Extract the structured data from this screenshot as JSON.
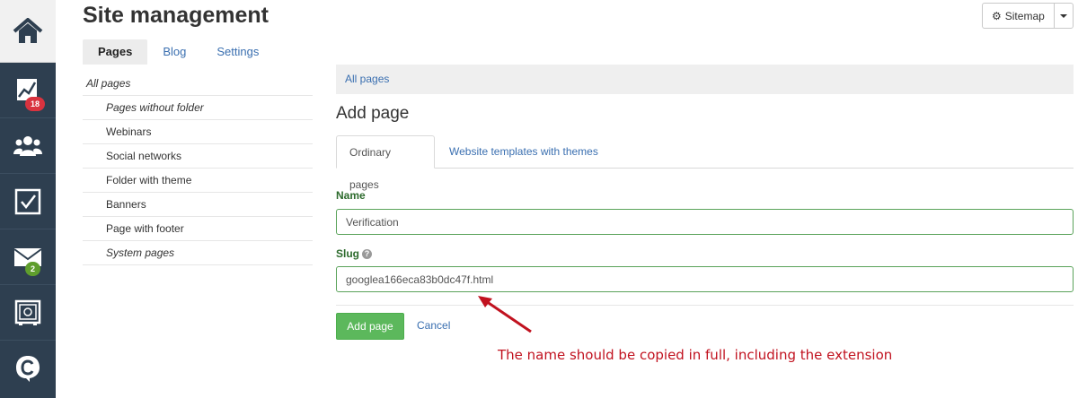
{
  "sidebar": {
    "items": [
      {
        "icon": "home-icon"
      },
      {
        "icon": "chart-icon",
        "badge": "18"
      },
      {
        "icon": "users-icon"
      },
      {
        "icon": "checkbox-icon"
      },
      {
        "icon": "mail-icon",
        "badge": "2"
      },
      {
        "icon": "safe-icon"
      },
      {
        "icon": "chat-icon"
      }
    ]
  },
  "header": {
    "title": "Site management",
    "tabs": [
      {
        "label": "Pages",
        "active": true
      },
      {
        "label": "Blog",
        "active": false
      },
      {
        "label": "Settings",
        "active": false
      }
    ],
    "sitemap_label": "Sitemap"
  },
  "folders": {
    "root": "All pages",
    "items": [
      {
        "label": "Pages without folder",
        "italic": true
      },
      {
        "label": "Webinars",
        "italic": false
      },
      {
        "label": "Social networks",
        "italic": false
      },
      {
        "label": "Folder with theme",
        "italic": false
      },
      {
        "label": "Banners",
        "italic": false
      },
      {
        "label": "Page with footer",
        "italic": false
      },
      {
        "label": "System pages",
        "italic": true
      }
    ]
  },
  "main": {
    "breadcrumb": "All pages",
    "section_title": "Add page",
    "tabs": [
      {
        "label": "Ordinary pages",
        "active": true
      },
      {
        "label": "Website templates with themes",
        "active": false
      }
    ],
    "name_label": "Name",
    "name_value": "Verification",
    "slug_label": "Slug",
    "slug_value": "googlea166eca83b0dc47f.html",
    "add_button": "Add page",
    "cancel_link": "Cancel"
  },
  "annotation": {
    "text": "The name should be copied in full, including the extension",
    "color": "#c1121f"
  },
  "colors": {
    "rail": "#2e3f50",
    "accent_green": "#5cb85c",
    "link_blue": "#3a6fb0",
    "badge_red": "#d9333f",
    "badge_green": "#5f9e2d"
  }
}
